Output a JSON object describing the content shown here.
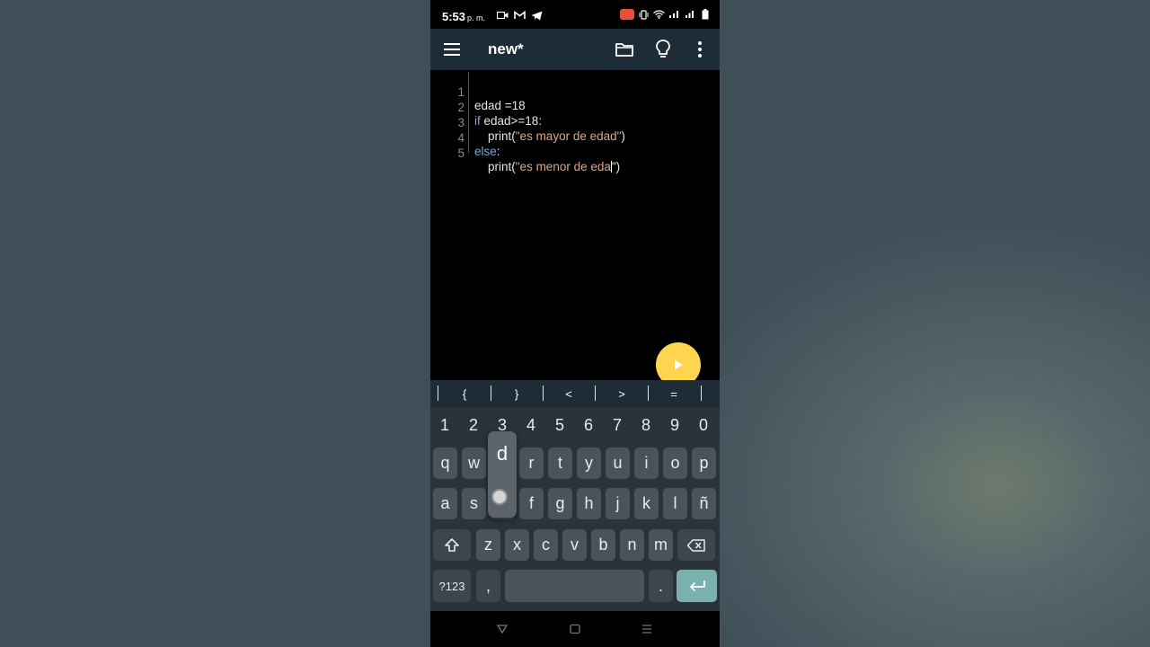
{
  "status_bar": {
    "time": "5:53",
    "ampm": "p. m."
  },
  "app_bar": {
    "title": "new*",
    "icons": [
      "menu-icon",
      "folder-icon",
      "lightbulb-icon",
      "more-vert-icon"
    ]
  },
  "editor": {
    "lines": [
      {
        "number": "1",
        "tokens": [
          {
            "text": "edad =18",
            "kind": "plain"
          }
        ]
      },
      {
        "number": "2",
        "tokens": [
          {
            "text": "if",
            "kind": "keyword"
          },
          {
            "text": " edad>=18:",
            "kind": "plain"
          }
        ]
      },
      {
        "number": "3",
        "tokens": [
          {
            "text": "    print(",
            "kind": "plain"
          },
          {
            "text": "\"es mayor de edad\"",
            "kind": "string"
          },
          {
            "text": ")",
            "kind": "plain"
          }
        ]
      },
      {
        "number": "4",
        "tokens": [
          {
            "text": "else",
            "kind": "keyword"
          },
          {
            "text": ":",
            "kind": "plain"
          }
        ]
      },
      {
        "number": "5",
        "tokens": [
          {
            "text": "    print(",
            "kind": "plain"
          },
          {
            "text": "\"es menor de eda",
            "kind": "string"
          },
          {
            "text": "\")",
            "kind": "plain"
          }
        ]
      }
    ],
    "run_button_icon": "play-icon"
  },
  "symbol_bar": {
    "symbols": [
      "{",
      "}",
      "<",
      ">",
      "="
    ]
  },
  "keyboard": {
    "numbers": [
      "1",
      "2",
      "3",
      "4",
      "5",
      "6",
      "7",
      "8",
      "9",
      "0"
    ],
    "row1": [
      "q",
      "w",
      "e",
      "r",
      "t",
      "y",
      "u",
      "i",
      "o",
      "p"
    ],
    "row2": [
      "a",
      "s",
      "d",
      "f",
      "g",
      "h",
      "j",
      "k",
      "l",
      "ñ"
    ],
    "row3": [
      "z",
      "x",
      "c",
      "v",
      "b",
      "n",
      "m"
    ],
    "symbols_key": "?123",
    "comma": ",",
    "period": ".",
    "popup_letter": "d"
  },
  "colors": {
    "app_bar": "#1e2c38",
    "keyword": "#7ea6d8",
    "string": "#d9a98a",
    "run_button": "#ffd54f",
    "enter_key": "#7ab0ad"
  }
}
